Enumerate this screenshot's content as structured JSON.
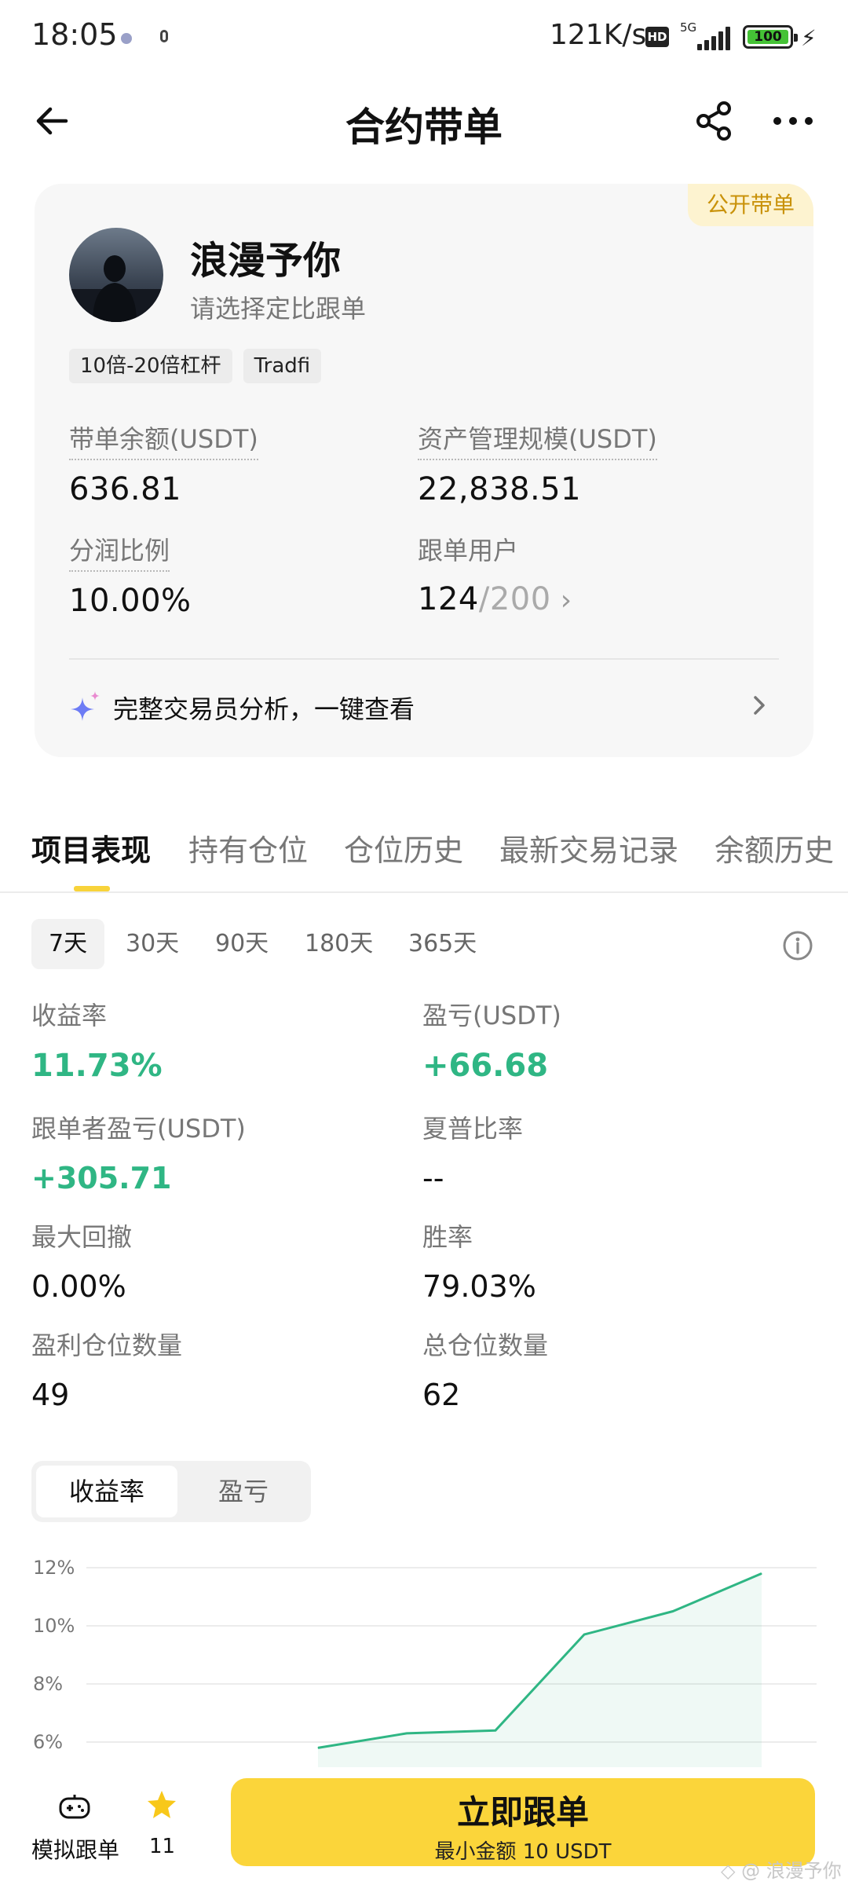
{
  "status_bar": {
    "time": "18:05",
    "speed": "121K/s",
    "hd": "HD",
    "network": "5G",
    "battery": "100"
  },
  "header": {
    "title": "合约带单",
    "icons": [
      "back-arrow-icon",
      "share-icon",
      "more-icon"
    ]
  },
  "trader": {
    "badge": "公开带单",
    "name": "浪漫予你",
    "subtitle": "请选择定比跟单",
    "tags": [
      "10倍-20倍杠杆",
      "Tradfi"
    ],
    "stats": {
      "balance_label": "带单余额(USDT)",
      "balance_value": "636.81",
      "aum_label": "资产管理规模(USDT)",
      "aum_value": "22,838.51",
      "profit_share_label": "分润比例",
      "profit_share_value": "10.00%",
      "followers_label": "跟单用户",
      "followers_current": "124",
      "followers_max": "/200"
    },
    "analysis_text": "完整交易员分析，一键查看"
  },
  "tabs": [
    "项目表现",
    "持有仓位",
    "仓位历史",
    "最新交易记录",
    "余额历史"
  ],
  "periods": [
    "7天",
    "30天",
    "90天",
    "180天",
    "365天"
  ],
  "metrics": {
    "roi_label": "收益率",
    "roi_value": "11.73%",
    "pnl_label": "盈亏(USDT)",
    "pnl_value": "+66.68",
    "follower_pnl_label": "跟单者盈亏(USDT)",
    "follower_pnl_value": "+305.71",
    "sharpe_label": "夏普比率",
    "sharpe_value": "--",
    "max_drawdown_label": "最大回撤",
    "max_drawdown_value": "0.00%",
    "win_rate_label": "胜率",
    "win_rate_value": "79.03%",
    "win_positions_label": "盈利仓位数量",
    "win_positions_value": "49",
    "total_positions_label": "总仓位数量",
    "total_positions_value": "62"
  },
  "chart_toggle": {
    "active": "收益率",
    "inactive": "盈亏"
  },
  "chart_data": {
    "type": "area",
    "title": "",
    "xlabel": "",
    "ylabel": "",
    "y_ticks": [
      "12%",
      "10%",
      "8%",
      "6%"
    ],
    "y_tick_values": [
      12,
      10,
      8,
      6
    ],
    "ylim": [
      6,
      12.4
    ],
    "x": [
      0,
      1,
      2,
      3,
      4,
      5
    ],
    "values": [
      5.8,
      6.3,
      6.4,
      9.7,
      10.5,
      11.8
    ],
    "line_color": "#2fb684",
    "grid": true
  },
  "bottom": {
    "demo_label": "模拟跟单",
    "star_count": "11",
    "follow_main": "立即跟单",
    "follow_sub": "最小金额 10 USDT",
    "watermark": "◇ @ 浪漫予你"
  },
  "colors": {
    "accent": "#fbd53a",
    "positive": "#2fb684",
    "badge_text": "#c9920a"
  }
}
